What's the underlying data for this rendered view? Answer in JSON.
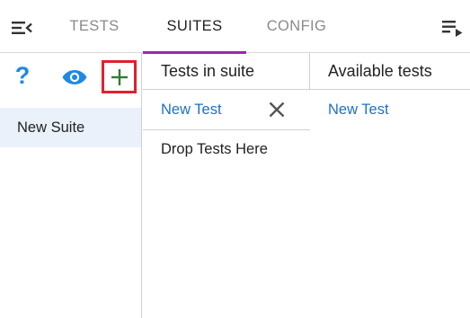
{
  "tabs": [
    {
      "label": "TESTS",
      "active": false
    },
    {
      "label": "SUITES",
      "active": true
    },
    {
      "label": "CONFIG",
      "active": false
    }
  ],
  "colors": {
    "accent": "#9c27b0",
    "link": "#1e6fc9",
    "help_icon": "#1e88e5",
    "eye_icon": "#1e88e5",
    "add_icon": "#2e7d32",
    "highlight_border": "#e0202f",
    "selected_row_bg": "#eaf1fb"
  },
  "icons": {
    "menu": "menu-collapse-icon",
    "playlist": "playlist-play-icon",
    "help": "question-mark-icon",
    "eye": "eye-icon",
    "add": "plus-icon",
    "remove": "close-icon"
  },
  "sidebar": {
    "help_label": "?",
    "suites": [
      {
        "name": "New Suite",
        "selected": true
      }
    ]
  },
  "tests_in_suite": {
    "header": "Tests in suite",
    "items": [
      {
        "name": "New Test"
      }
    ],
    "drop_placeholder": "Drop Tests Here"
  },
  "available_tests": {
    "header": "Available tests",
    "items": [
      {
        "name": "New Test"
      }
    ]
  }
}
